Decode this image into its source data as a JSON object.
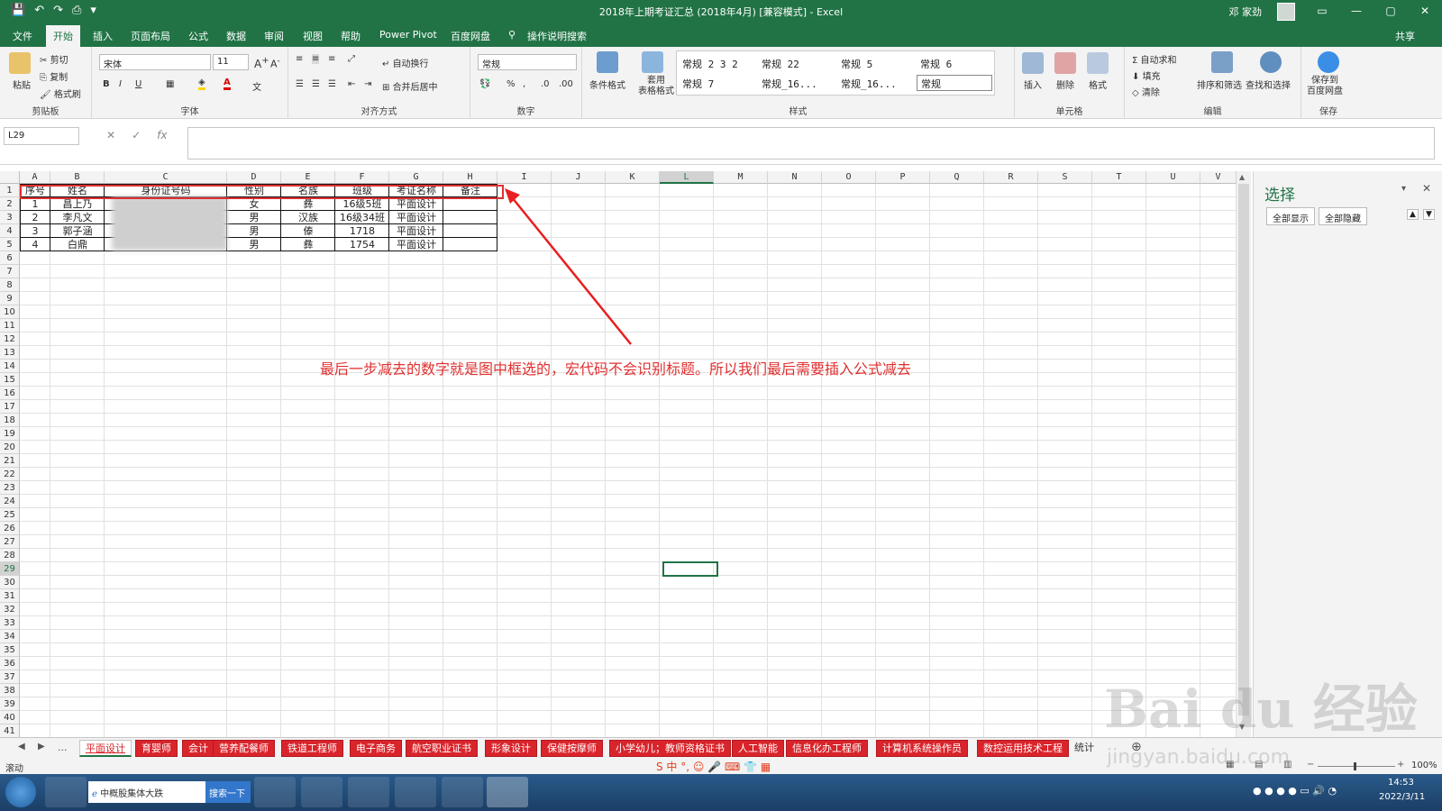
{
  "app": {
    "title": "2018年上期考证汇总 (2018年4月) [兼容模式] - Excel",
    "user": "邓 家劲",
    "win_min": "—",
    "win_max": "▢",
    "win_close": "✕"
  },
  "tabs": [
    "文件",
    "开始",
    "插入",
    "页面布局",
    "公式",
    "数据",
    "审阅",
    "视图",
    "帮助",
    "Power Pivot",
    "百度网盘",
    "操作说明搜索"
  ],
  "share_label": "共享",
  "ribbon": {
    "clipboard": {
      "label": "剪贴板",
      "paste": "粘贴",
      "cut": "剪切",
      "copy": "复制",
      "format_painter": "格式刷"
    },
    "font": {
      "label": "字体",
      "name": "宋体",
      "size": "11"
    },
    "alignment": {
      "label": "对齐方式",
      "wrap": "自动换行",
      "merge": "合并后居中"
    },
    "number": {
      "label": "数字",
      "format": "常规"
    },
    "styles": {
      "label": "样式",
      "cond_format": "条件格式",
      "table_format": "套用\n表格格式",
      "items": [
        "常规 2 3 2",
        "常规 22",
        "常规 5",
        "常规 6",
        "常规 7",
        "常规_16...",
        "常规_16...",
        "常规"
      ]
    },
    "cells": {
      "label": "单元格",
      "insert": "插入",
      "delete": "删除",
      "format": "格式"
    },
    "editing": {
      "label": "编辑",
      "autosum": "自动求和",
      "fill": "填充",
      "clear": "清除",
      "sort": "排序和筛选",
      "find": "查找和选择"
    },
    "save": {
      "label": "保存",
      "save_baidu": "保存到\n百度网盘"
    }
  },
  "formula_bar": {
    "name_box": "L29",
    "formula": ""
  },
  "sheet": {
    "columns": [
      "A",
      "B",
      "C",
      "D",
      "E",
      "F",
      "G",
      "H",
      "I",
      "J",
      "K",
      "L",
      "M",
      "N",
      "O",
      "P",
      "Q",
      "R",
      "S",
      "T",
      "U",
      "V"
    ],
    "selected_column": "L",
    "selected_row": "29",
    "rows": [
      "1",
      "2",
      "3",
      "4",
      "5",
      "6",
      "7",
      "8",
      "9",
      "10",
      "11",
      "12",
      "13",
      "14",
      "15",
      "16",
      "17",
      "18",
      "19",
      "20",
      "21",
      "22",
      "23",
      "24",
      "25",
      "26",
      "27",
      "28",
      "29",
      "30",
      "31",
      "32",
      "33",
      "34",
      "35",
      "36",
      "37",
      "38",
      "39",
      "40",
      "41"
    ],
    "headers": [
      "序号",
      "姓名",
      "身份证号码",
      "性别",
      "名族",
      "班级",
      "考证名称",
      "备注"
    ],
    "data": [
      [
        "1",
        "昌上乃",
        "",
        "女",
        "彝",
        "16级5班",
        "平面设计",
        ""
      ],
      [
        "2",
        "李凡文",
        "",
        "男",
        "汉族",
        "16级34班",
        "平面设计",
        ""
      ],
      [
        "3",
        "郭子涵",
        "",
        "男",
        "傣",
        "1718",
        "平面设计",
        ""
      ],
      [
        "4",
        "白鼎",
        "",
        "男",
        "彝",
        "1754",
        "平面设计",
        ""
      ]
    ]
  },
  "annotation": "最后一步减去的数字就是图中框选的，宏代码不会识别标题。所以我们最后需要插入公式减去",
  "selection_pane": {
    "title": "选择",
    "show_all": "全部显示",
    "hide_all": "全部隐藏"
  },
  "sheet_tabs": [
    "平面设计",
    "育婴师",
    "会计",
    "营养配餐师",
    "铁道工程师",
    "电子商务",
    "航空职业证书",
    "形象设计",
    "保健按摩师",
    "小学幼儿；教师资格证书",
    "人工智能",
    "信息化办工程师",
    "计算机系统操作员",
    "数控运用技术工程",
    "统计"
  ],
  "active_sheet_tab": "平面设计",
  "status": {
    "mode": "滚动",
    "zoom": "100%"
  },
  "taskbar": {
    "search_text": "中概股集体大跌",
    "search_button": "搜索一下",
    "time": "14:53",
    "date": "2022/3/11"
  },
  "watermark": {
    "text": "Bai du 经验",
    "url": "jingyan.baidu.com"
  }
}
